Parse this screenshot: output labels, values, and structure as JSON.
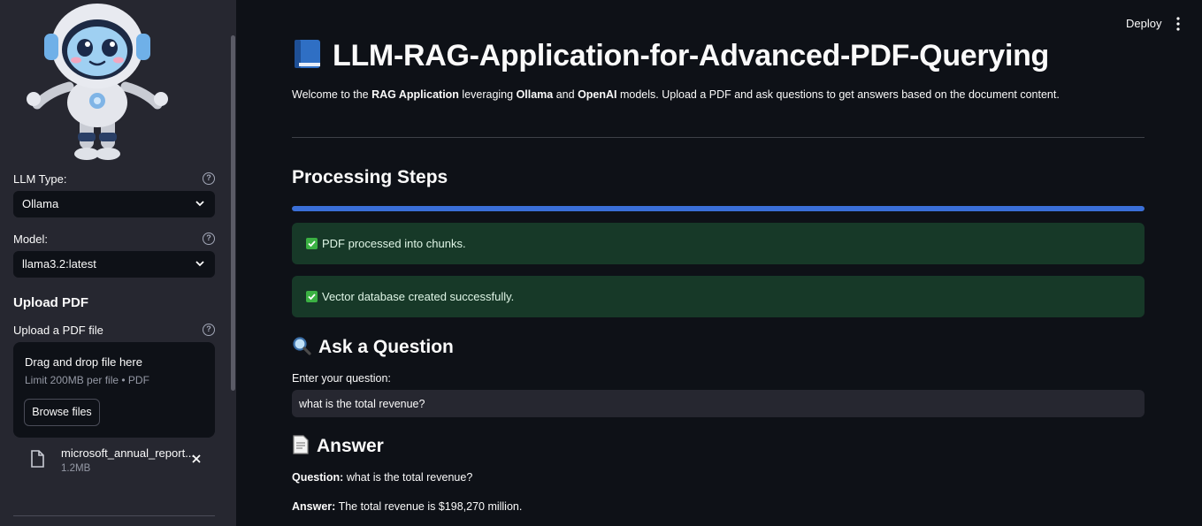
{
  "header": {
    "deploy_label": "Deploy",
    "menu_icon": "kebab-menu-icon"
  },
  "sidebar": {
    "logo_icon": "robot-mascot-icon",
    "llm_type": {
      "label": "LLM Type:",
      "value": "Ollama"
    },
    "model": {
      "label": "Model:",
      "value": "llama3.2:latest"
    },
    "upload_heading": "Upload PDF",
    "uploader": {
      "label": "Upload a PDF file",
      "dropzone_title": "Drag and drop file here",
      "dropzone_limit": "Limit 200MB per file • PDF",
      "browse_label": "Browse files"
    },
    "file": {
      "name": "microsoft_annual_report...",
      "size": "1.2MB"
    }
  },
  "main": {
    "title": "LLM-RAG-Application-for-Advanced-PDF-Querying",
    "title_icon": "blue-book-icon",
    "welcome": {
      "t1": "Welcome to the ",
      "b1": "RAG Application",
      "t2": " leveraging ",
      "b2": "Ollama",
      "t3": " and ",
      "b3": "OpenAI",
      "t4": " models. Upload a PDF and ask questions to get answers based on the document content."
    },
    "processing_heading": "Processing Steps",
    "progress_fraction": 1.0,
    "status_messages": [
      "PDF processed into chunks.",
      "Vector database created successfully."
    ],
    "ask_heading": "Ask a Question",
    "ask_icon": "magnifier-icon",
    "question_label": "Enter your question:",
    "question_value": "what is the total revenue?",
    "answer_heading": "Answer",
    "answer_icon": "document-icon",
    "question_prefix": "Question:",
    "question_text": " what is the total revenue?",
    "answer_prefix": "Answer:",
    "answer_text": " The total revenue is $198,270 million."
  },
  "colors": {
    "background": "#0e1117",
    "sidebar": "#262730",
    "progress": "#3a6fd8",
    "success_bg": "#173928",
    "success_check": "#3bb143"
  }
}
